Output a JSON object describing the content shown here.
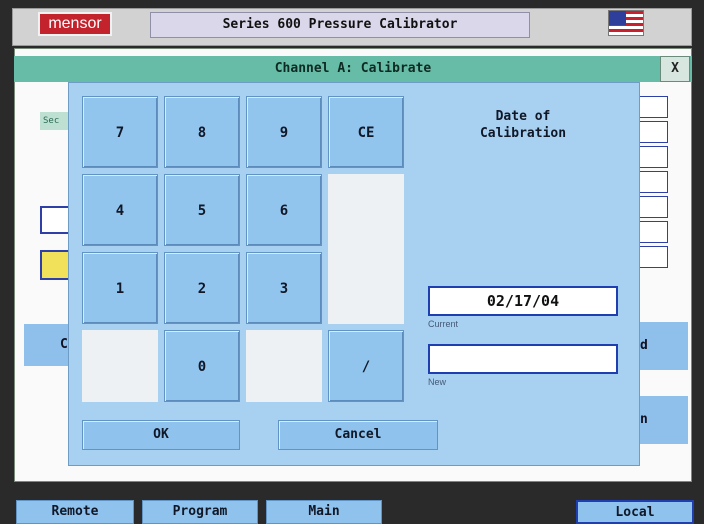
{
  "header": {
    "logo_text": "mensor",
    "title": "Series 600 Pressure Calibrator",
    "flag_icon": "us-flag-icon"
  },
  "window": {
    "title": "Channel A: Calibrate",
    "close_label": "X",
    "background": {
      "section_label": "Sec",
      "left_button_label": "C",
      "right_button_1_label": "d",
      "right_button_2_label": "n"
    }
  },
  "keypad": {
    "keys": {
      "k7": "7",
      "k8": "8",
      "k9": "9",
      "ce": "CE",
      "k4": "4",
      "k5": "5",
      "k6": "6",
      "k1": "1",
      "k2": "2",
      "k3": "3",
      "k0": "0",
      "slash": "/"
    },
    "ok_label": "OK",
    "cancel_label": "Cancel"
  },
  "date": {
    "title_line1": "Date of",
    "title_line2": "Calibration",
    "current_value": "02/17/04",
    "current_label": "Current",
    "new_value": "",
    "new_label": "New"
  },
  "nav": {
    "remote": "Remote",
    "program": "Program",
    "main": "Main",
    "local": "Local",
    "active": "Local"
  },
  "colors": {
    "title_bar": "#66bca6",
    "key": "#92c5ee",
    "dialog": "#a8d0f0",
    "field_border": "#1f3fb0",
    "logo": "#c2232c"
  }
}
